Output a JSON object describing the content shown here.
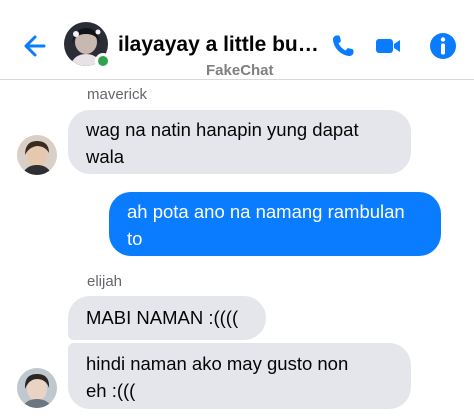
{
  "header": {
    "back_icon": "arrow-left-icon",
    "title": "ilayayay a little butt…",
    "subtitle": "FakeChat",
    "call_icon": "phone-icon",
    "video_icon": "video-camera-icon",
    "info_icon": "info-icon",
    "accent_color": "#0a7cff",
    "online_color": "#31a24c"
  },
  "messages": [
    {
      "sender": "maverick",
      "direction": "incoming",
      "text_lines": [
        "wag na natin hanapin yung dapat",
        "wala"
      ]
    },
    {
      "sender": "",
      "direction": "outgoing",
      "text_lines": [
        "ah pota ano na namang rambulan",
        "to"
      ]
    },
    {
      "sender": "elijah",
      "direction": "incoming",
      "text_lines": [
        "MABI NAMAN :(((("
      ]
    },
    {
      "sender": "",
      "direction": "incoming",
      "text_lines": [
        "hindi naman ako may gusto non",
        "eh :((("
      ]
    }
  ]
}
